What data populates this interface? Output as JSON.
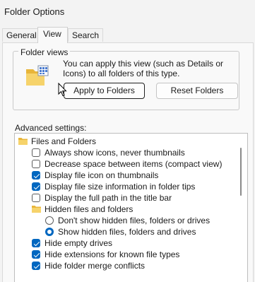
{
  "window": {
    "title": "Folder Options"
  },
  "tabs": [
    {
      "label": "General",
      "active": false
    },
    {
      "label": "View",
      "active": true
    },
    {
      "label": "Search",
      "active": false
    }
  ],
  "folder_views": {
    "heading": "Folder views",
    "description": "You can apply this view (such as Details or Icons) to all folders of this type.",
    "apply_button": "Apply to Folders",
    "reset_button": "Reset Folders"
  },
  "advanced": {
    "label": "Advanced settings:",
    "items": [
      {
        "type": "folder",
        "label": "Files and Folders"
      },
      {
        "type": "checkbox",
        "label": "Always show icons, never thumbnails",
        "checked": false
      },
      {
        "type": "checkbox",
        "label": "Decrease space between items (compact view)",
        "checked": false
      },
      {
        "type": "checkbox",
        "label": "Display file icon on thumbnails",
        "checked": true
      },
      {
        "type": "checkbox",
        "label": "Display file size information in folder tips",
        "checked": true
      },
      {
        "type": "checkbox",
        "label": "Display the full path in the title bar",
        "checked": false
      },
      {
        "type": "folder",
        "label": "Hidden files and folders"
      },
      {
        "type": "radio",
        "label": "Don't show hidden files, folders or drives",
        "checked": false
      },
      {
        "type": "radio",
        "label": "Show hidden files, folders and drives",
        "checked": true
      },
      {
        "type": "checkbox",
        "label": "Hide empty drives",
        "checked": true
      },
      {
        "type": "checkbox",
        "label": "Hide extensions for known file types",
        "checked": true
      },
      {
        "type": "checkbox",
        "label": "Hide folder merge conflicts",
        "checked": true
      }
    ]
  },
  "colors": {
    "accent": "#0067c0",
    "folder": "#f2c94c"
  }
}
